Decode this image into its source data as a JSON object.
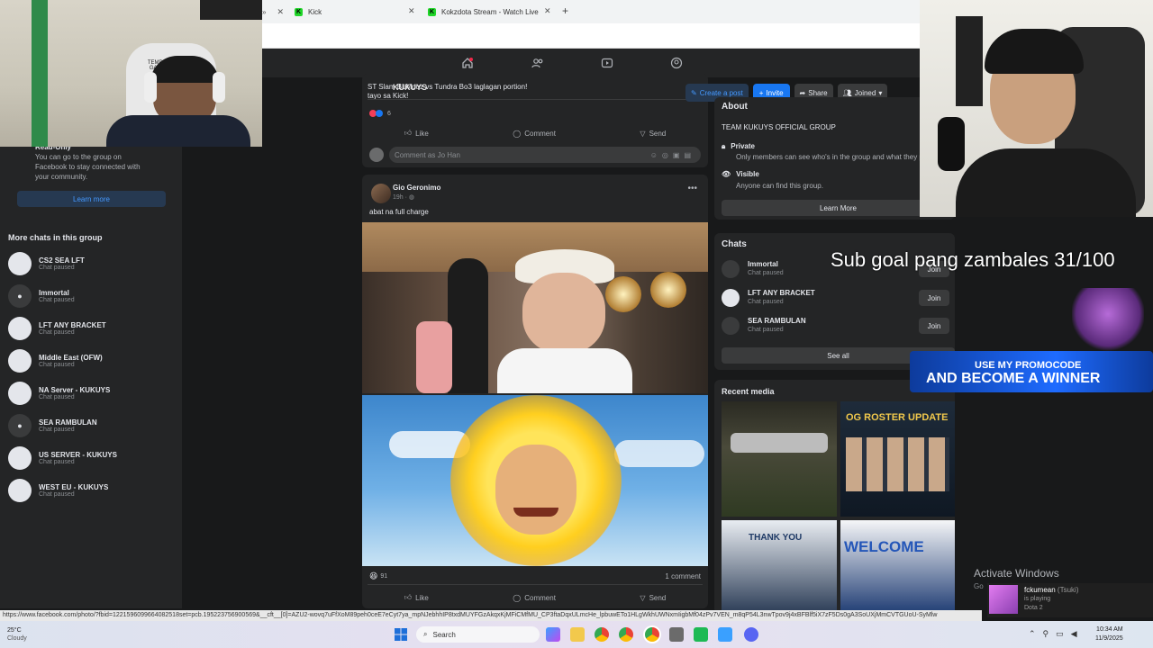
{
  "browser": {
    "tabs": [
      {
        "label": "Kick"
      },
      {
        "label": "Kokzdota Stream - Watch Live"
      }
    ],
    "new_tab": "+"
  },
  "left_panel": {
    "read_only_title": "Read-Only",
    "read_only_text": "You can go to the group on Facebook to stay connected with your community.",
    "learn_more": "Learn more",
    "more_chats_heading": "More chats in this group",
    "chats": [
      {
        "name": "CS2 SEA LFT",
        "status": "Chat paused",
        "avatar": "light"
      },
      {
        "name": "Immortal",
        "status": "Chat paused",
        "avatar": "dark"
      },
      {
        "name": "LFT ANY BRACKET",
        "status": "Chat paused",
        "avatar": "light"
      },
      {
        "name": "Middle East (OFW)",
        "status": "Chat paused",
        "avatar": "light"
      },
      {
        "name": "NA Server - KUKUYS",
        "status": "Chat paused",
        "avatar": "light"
      },
      {
        "name": "SEA RAMBULAN",
        "status": "Chat paused",
        "avatar": "dark"
      },
      {
        "name": "US SERVER - KUKUYS",
        "status": "Chat paused",
        "avatar": "light"
      },
      {
        "name": "WEST EU - KUKUYS",
        "status": "Chat paused",
        "avatar": "light"
      }
    ]
  },
  "feed": {
    "post1": {
      "text_line1": "ST Slam BLMouz vs Tundra Bo3 laglagan portion!",
      "text_line2": "tayo sa Kick!",
      "overlay_tag": "KUKUYS",
      "reaction_count": "6",
      "like": "Like",
      "comment": "Comment",
      "send": "Send",
      "comment_placeholder": "Comment as Jo Han"
    },
    "post2": {
      "author": "Gio Geronimo",
      "time": "19h",
      "caption": "abat na full charge",
      "reaction_count": "91",
      "comment_count": "1 comment",
      "like": "Like",
      "comment": "Comment",
      "send": "Send"
    }
  },
  "right_col": {
    "create_post": "Create a post",
    "invite": "Invite",
    "share": "Share",
    "joined": "Joined",
    "about_title": "About",
    "group_name": "TEAM KUKUYS OFFICIAL GROUP",
    "private_title": "Private",
    "private_desc": "Only members can see who's in the group and what they post.",
    "visible_title": "Visible",
    "visible_desc": "Anyone can find this group.",
    "learn_more": "Learn More",
    "chats_title": "Chats",
    "chats": [
      {
        "name": "Immortal",
        "status": "Chat paused",
        "join": "Join"
      },
      {
        "name": "LFT ANY BRACKET",
        "status": "Chat paused",
        "join": "Join"
      },
      {
        "name": "SEA RAMBULAN",
        "status": "Chat paused",
        "join": "Join"
      }
    ],
    "see_all": "See all",
    "recent_media_title": "Recent media",
    "media_label_og": "OG ROSTER UPDATE",
    "media_label_thanks": "THANK YOU",
    "media_label_welcome": "WELCOME"
  },
  "overlays": {
    "sub_goal": "Sub goal pang zambales 31/100",
    "promo_line1": "USE MY PROMOCODE",
    "promo_line2": "AND BECOME A WINNER",
    "activate_windows": "Activate Windows",
    "activate_sub": "Go",
    "notif_user": "fckumean",
    "notif_user_alt": "(Tsuki)",
    "notif_playing": "is playing",
    "notif_game": "Dota 2",
    "cam_chair_text": "TEMPEST GAMING"
  },
  "status_url": "https://www.facebook.com/photo/?fbid=1221596099664082518set=pcb.195223756900569&__cft__[0]=AZU2-wovq7uFfXoM89peh0ceE7eCyt7ya_mpNJebhhIP8txdMUYFGzAkqxKjMFiCMfMU_CP3ftaDqxULmcHe_lpbuwETo1HLgWkhUWNxmIigbMf04zPv7VEN_m8qP54L3nwTpov9j4xBFBlf5iX7zF5Ds0gA3SoUXjMmCVTGUoU-SyMlw",
  "taskbar": {
    "weather_temp": "25°C",
    "weather_desc": "Cloudy",
    "search": "Search",
    "time": "10:34 AM",
    "date": "11/9/2025"
  }
}
